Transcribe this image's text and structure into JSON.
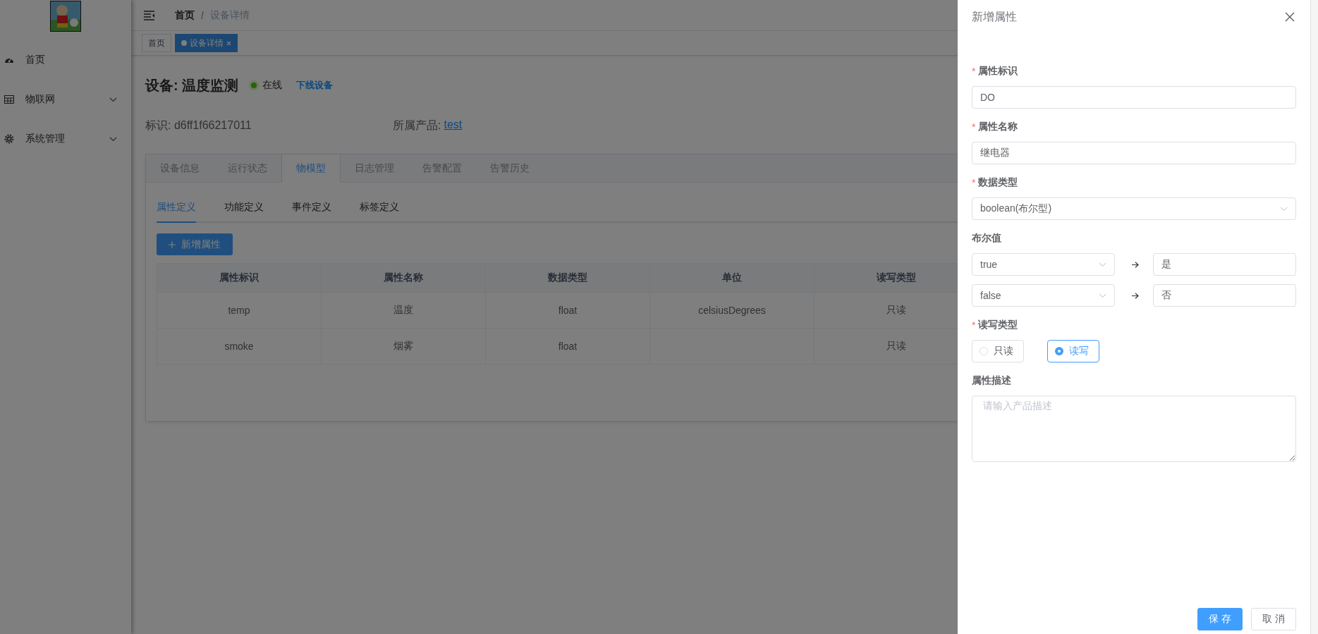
{
  "sidebar": {
    "items": [
      {
        "label": "首页",
        "kind": "dashboard",
        "expandable": false
      },
      {
        "label": "物联网",
        "kind": "grid",
        "expandable": true
      },
      {
        "label": "系统管理",
        "kind": "gear",
        "expandable": true
      }
    ]
  },
  "breadcrumb": {
    "separator": "/",
    "items": [
      {
        "label": "首页",
        "current": false
      },
      {
        "label": "设备详情",
        "current": true
      }
    ]
  },
  "tags": [
    {
      "label": "首页",
      "selected": false
    },
    {
      "label": "设备详情",
      "selected": true
    }
  ],
  "device": {
    "title": "设备: 温度监测",
    "status": "在线",
    "online": true,
    "action": "下线设备",
    "identifier": "标识: d6ff1f66217011",
    "product_label": "所属产品:",
    "product_link": "test"
  },
  "tabs": [
    {
      "label": "设备信息",
      "selected": false
    },
    {
      "label": "运行状态",
      "selected": false
    },
    {
      "label": "物模型",
      "selected": true
    },
    {
      "label": "日志管理",
      "selected": false
    },
    {
      "label": "告警配置",
      "selected": false
    },
    {
      "label": "告警历史",
      "selected": false
    }
  ],
  "subtabs": [
    {
      "label": "属性定义",
      "selected": true
    },
    {
      "label": "功能定义",
      "selected": false
    },
    {
      "label": "事件定义",
      "selected": false
    },
    {
      "label": "标签定义",
      "selected": false
    }
  ],
  "add_button": "新增属性",
  "table": {
    "columns": [
      "属性标识",
      "属性名称",
      "数据类型",
      "单位",
      "读写类型"
    ],
    "rows": [
      [
        "temp",
        "温度",
        "float",
        "celsiusDegrees",
        "只读"
      ],
      [
        "smoke",
        "烟雾",
        "float",
        "",
        "只读"
      ]
    ]
  },
  "drawer": {
    "title": "新增属性",
    "required_mark": "*",
    "fields": [
      {
        "kind": "input",
        "label": "属性标识",
        "required": true,
        "value": "DO"
      },
      {
        "kind": "input",
        "label": "属性名称",
        "required": true,
        "value": "继电器"
      },
      {
        "kind": "select",
        "label": "数据类型",
        "required": true,
        "value": "boolean(布尔型)"
      },
      {
        "kind": "bool_map",
        "label": "布尔值",
        "required": false,
        "rows": [
          {
            "key": "true",
            "value": "是"
          },
          {
            "key": "false",
            "value": "否"
          }
        ]
      },
      {
        "kind": "radio",
        "label": "读写类型",
        "required": true,
        "options": [
          {
            "label": "只读",
            "selected": false
          },
          {
            "label": "读写",
            "selected": true
          }
        ]
      },
      {
        "kind": "textarea",
        "label": "属性描述",
        "required": false,
        "placeholder": "请输入产品描述"
      }
    ],
    "buttons": [
      {
        "label": "保 存",
        "kind": "primary"
      },
      {
        "label": "取 消",
        "kind": "default"
      }
    ]
  }
}
